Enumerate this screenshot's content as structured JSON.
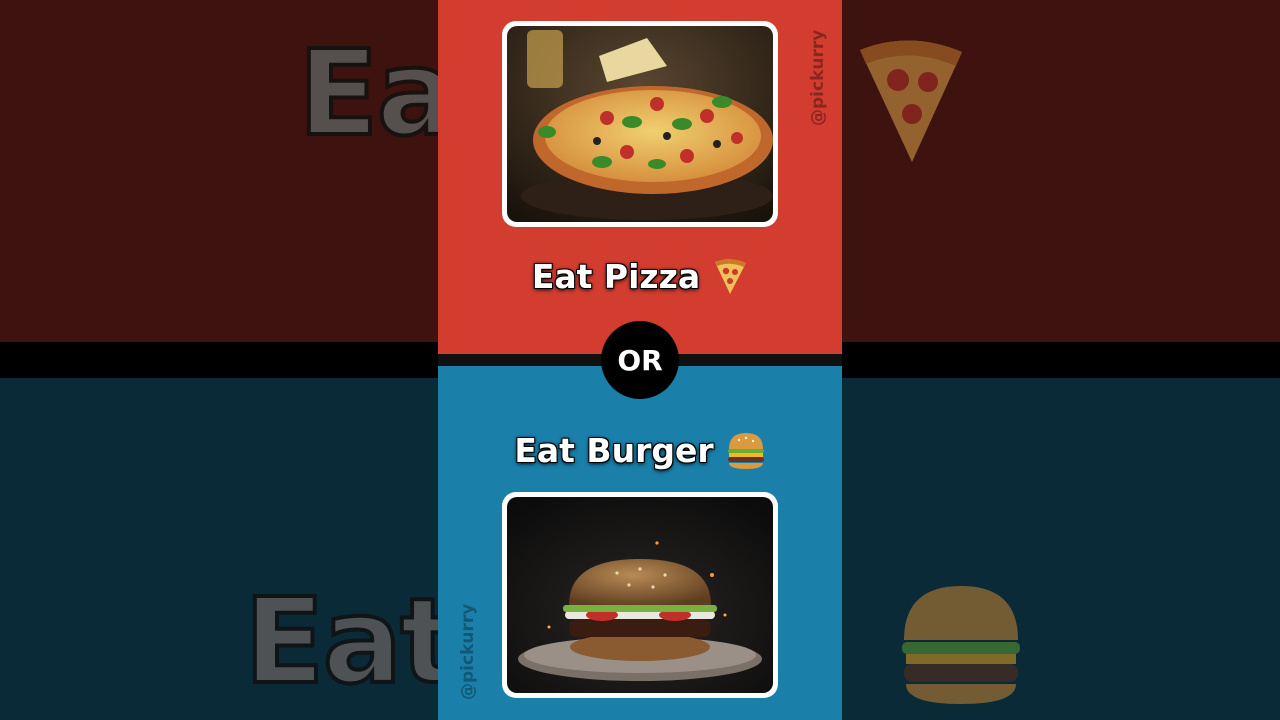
{
  "background": {
    "top_ghost_text": "Eat",
    "bottom_ghost_text": "Eat",
    "top_ghost_icon": "pizza-slice-icon",
    "bottom_ghost_icon": "burger-icon",
    "colors": {
      "top": "#3e120e",
      "bottom": "#0a2a38"
    }
  },
  "options": {
    "top": {
      "label": "Eat Pizza",
      "icon": "pizza-slice-icon",
      "image": "pizza-photo",
      "panel_color": "#d33d30"
    },
    "bottom": {
      "label": "Eat Burger",
      "icon": "burger-icon",
      "image": "burger-photo",
      "panel_color": "#1a7fa9"
    }
  },
  "divider": {
    "label": "OR"
  },
  "watermark": {
    "text": "@pickurry"
  }
}
